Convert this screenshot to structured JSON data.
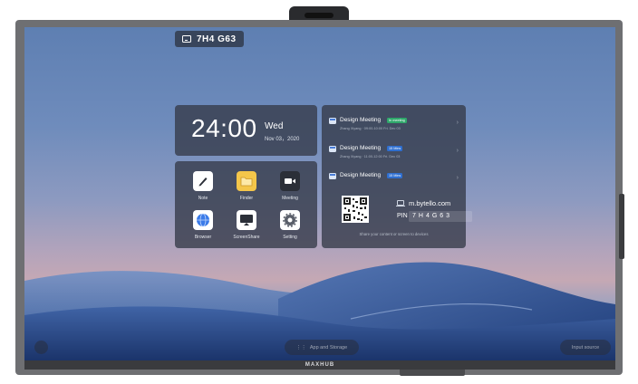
{
  "room_code": "7H4 G63",
  "clock": {
    "time": "24:00",
    "day": "Wed",
    "date": "Nov 03，2020"
  },
  "apps": [
    {
      "label": "Note",
      "icon": "pen-icon"
    },
    {
      "label": "Finder",
      "icon": "folder-icon"
    },
    {
      "label": "Meeting",
      "icon": "video-camera-icon"
    },
    {
      "label": "Browser",
      "icon": "globe-icon"
    },
    {
      "label": "ScreenShare",
      "icon": "screen-share-icon"
    },
    {
      "label": "Setting",
      "icon": "gear-icon"
    }
  ],
  "meetings": [
    {
      "title": "Design Meeting",
      "badge": "In meeting",
      "badge_color": "#2fa86b",
      "sub": "Zhang Xiyang · 09:00-10:00 Fri. Dec 03"
    },
    {
      "title": "Design Meeting",
      "badge": "15 Mins",
      "badge_color": "#2f6fd0",
      "sub": "Zhang Xiyang · 11:00-12:00 Fri. Dec 03"
    },
    {
      "title": "Design Meeting",
      "badge": "15 Mins",
      "badge_color": "#2f6fd0",
      "sub": ""
    }
  ],
  "join": {
    "url": "m.bytello.com",
    "pin_label": "PIN",
    "pin": "7H4G63",
    "hint": "Share your content or screen to devices"
  },
  "dock": {
    "center_label": "App and Storage",
    "right_label": "Input source"
  },
  "brand": "MAXHUB"
}
